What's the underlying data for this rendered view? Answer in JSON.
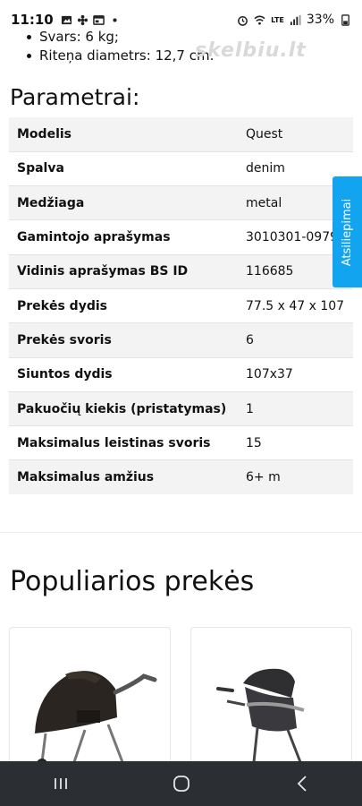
{
  "status_bar": {
    "time": "11:10",
    "battery": "33%",
    "network_label": "LTE"
  },
  "bullets": [
    "Svars: 6 kg;",
    "Riteņa diametrs: 12,7 cm."
  ],
  "watermark": "skelbiu.lt",
  "params_heading": "Parametrai:",
  "specs": [
    {
      "label": "Modelis",
      "value": "Quest"
    },
    {
      "label": "Spalva",
      "value": "denim"
    },
    {
      "label": "Medžiaga",
      "value": "metal"
    },
    {
      "label": "Gamintojo aprašymas",
      "value": "3010301-0979"
    },
    {
      "label": "Vidinis aprašymas BS ID",
      "value": "116685"
    },
    {
      "label": "Prekės dydis",
      "value": "77.5 x 47 x 107"
    },
    {
      "label": "Prekės svoris",
      "value": "6"
    },
    {
      "label": "Siuntos dydis",
      "value": "107x37"
    },
    {
      "label": "Pakuočių kiekis (pristatymas)",
      "value": "1"
    },
    {
      "label": "Maksimalus leistinas svoris",
      "value": "15"
    },
    {
      "label": "Maksimalus amžius",
      "value": "6+ m"
    }
  ],
  "feedback_tab": "Atsiliepimai",
  "popular_heading": "Populiarios prekės",
  "colors": {
    "feedback_tab": "#13a4ef",
    "nav_bar": "#2b2f33",
    "row_stripe": "#f3f3f3"
  },
  "icons": {
    "nav": [
      "recent-apps-icon",
      "home-icon",
      "back-icon"
    ]
  }
}
